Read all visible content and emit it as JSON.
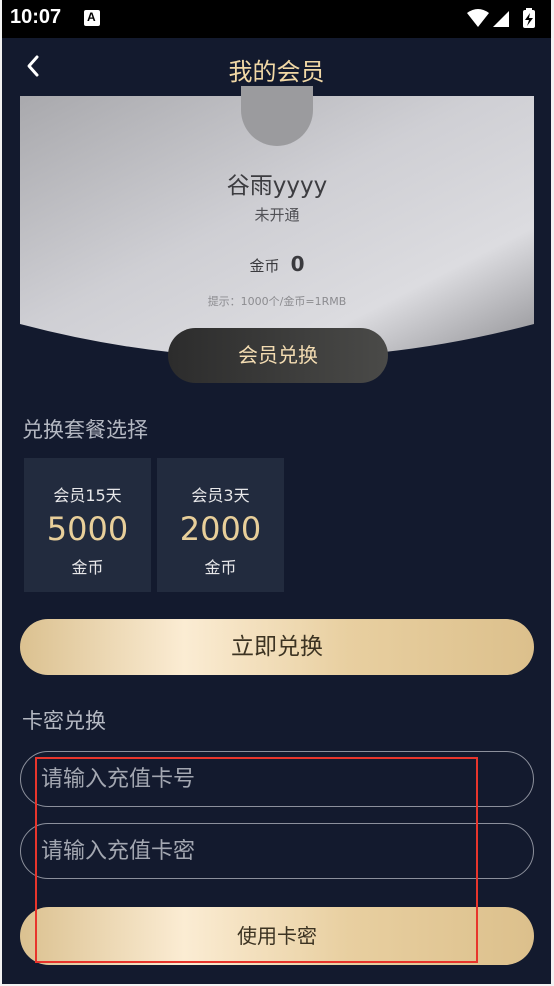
{
  "status_bar": {
    "time": "10:07",
    "icons": [
      "a-notification-icon",
      "wifi-icon",
      "signal-icon",
      "battery-charging-icon"
    ]
  },
  "nav": {
    "title": "我的会员",
    "back_icon": "chevron-left-icon"
  },
  "profile": {
    "username": "谷雨yyyy",
    "member_status": "未开通",
    "coins_label": "金币",
    "coins_value": "0",
    "hint": "提示：1000个/金币=1RMB",
    "redeem_button": "会员兑换"
  },
  "packages_section": {
    "title": "兑换套餐选择",
    "items": [
      {
        "name": "会员15天",
        "price": "5000",
        "unit": "金币"
      },
      {
        "name": "会员3天",
        "price": "2000",
        "unit": "金币"
      }
    ],
    "redeem_now_button": "立即兑换"
  },
  "card_section": {
    "title": "卡密兑换",
    "card_number_placeholder": "请输入充值卡号",
    "card_password_placeholder": "请输入充值卡密",
    "use_button": "使用卡密"
  },
  "colors": {
    "background": "#131a2e",
    "accent_gold": "#e8cf9a",
    "highlight_red": "#e8352c"
  }
}
